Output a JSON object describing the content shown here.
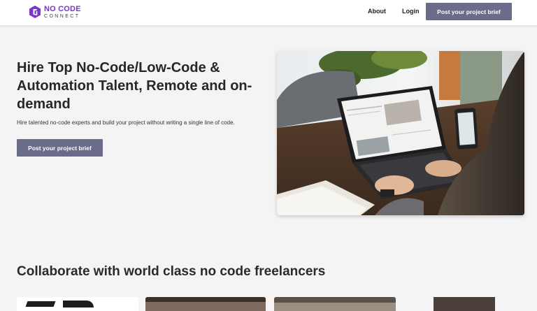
{
  "brand": {
    "name_line1": "NO CODE",
    "name_line2": "CONNECT",
    "accent": "#7a35c9"
  },
  "nav": {
    "about": "About",
    "login": "Login",
    "cta": "Post your project brief"
  },
  "hero": {
    "title": "Hire Top No-Code/Low-Code & Automation Talent, Remote and on-demand",
    "subtitle": "Hire talented no-code experts and build your project without writing a single line of code.",
    "cta": "Post your project brief",
    "image_icon": "laptop-photo"
  },
  "section": {
    "title": "Collaborate with world class no code freelancers"
  },
  "colors": {
    "button_bg": "#6b6b8a",
    "page_bg": "#f4f4f5"
  }
}
